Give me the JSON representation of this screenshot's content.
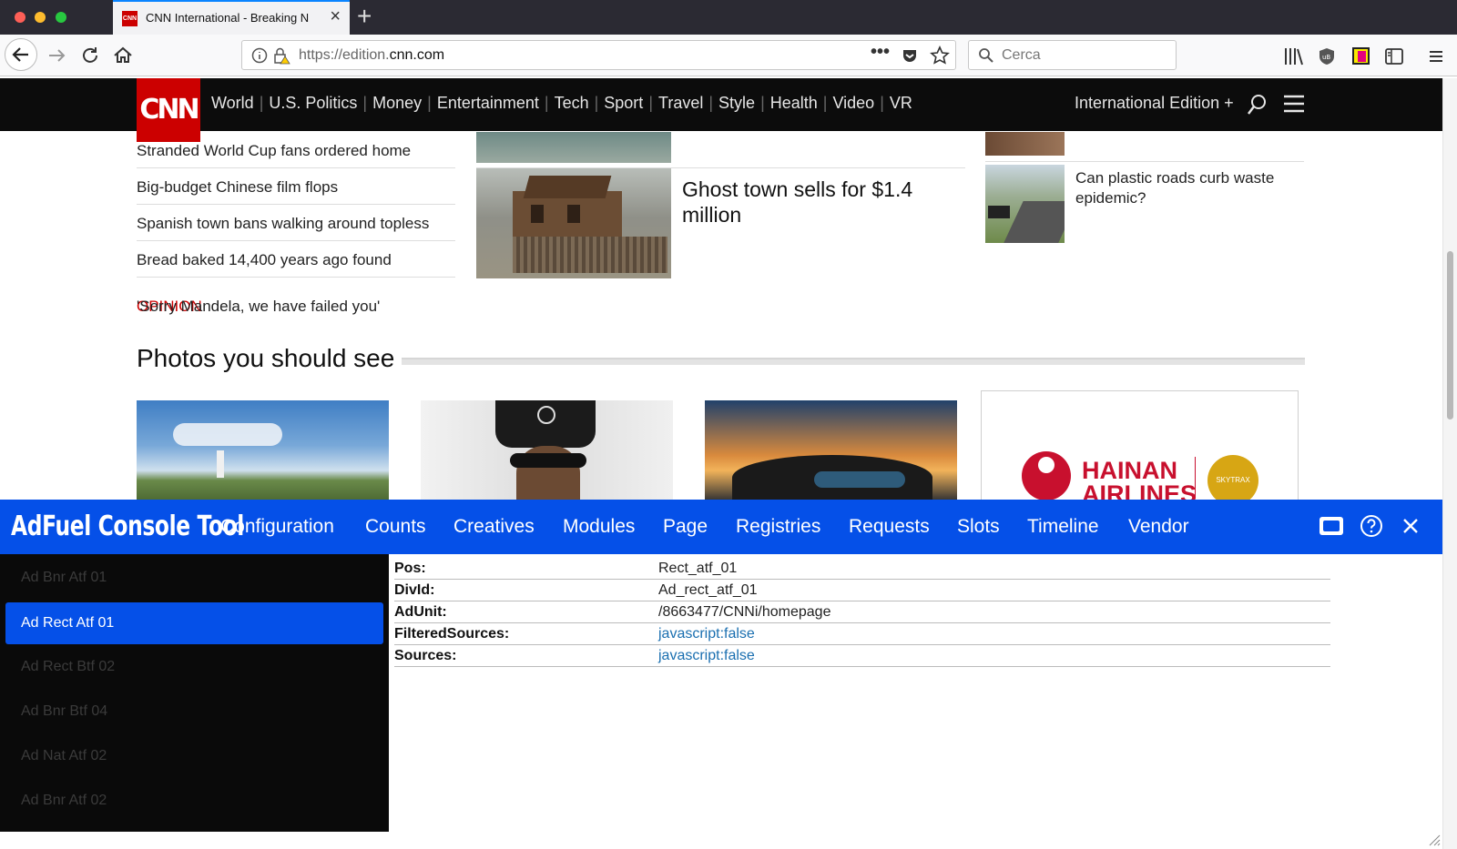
{
  "browser": {
    "tab_title": "CNN International - Breaking N",
    "favicon_text": "CNN",
    "url_prefix": "https://edition.",
    "url_domain": "cnn.com",
    "search_placeholder": "Cerca"
  },
  "cnn": {
    "logo": "CNN",
    "nav": [
      "World",
      "U.S. Politics",
      "Money",
      "Entertainment",
      "Tech",
      "Sport",
      "Travel",
      "Style",
      "Health",
      "Video",
      "VR"
    ],
    "edition": "International Edition +",
    "headlines": [
      "Stranded World Cup fans ordered home",
      "Big-budget Chinese film flops",
      "Spanish town bans walking around topless",
      "Bread baked 14,400 years ago found"
    ],
    "opinion_label": "OPINION",
    "opinion_text": " 'Sorry Mandela, we have failed you'",
    "feature_headline": "Ghost town sells for $1.4 million",
    "side_headline": "Can plastic roads curb waste epidemic?",
    "photos_heading": "Photos you should see",
    "ad_brand_line1": "HAINAN",
    "ad_brand_line2": "AIRLINES",
    "ad_badge": "SKYTRAX"
  },
  "console": {
    "title": "AdFuel Console Tool",
    "menu": [
      "Configuration",
      "Counts",
      "Creatives",
      "Modules",
      "Page",
      "Registries",
      "Requests",
      "Slots",
      "Timeline",
      "Vendor"
    ],
    "slots": [
      "Ad Bnr Atf 01",
      "Ad Rect Atf 01",
      "Ad Rect Btf 02",
      "Ad Bnr Btf 04",
      "Ad Nat Atf 02",
      "Ad Bnr Atf 02"
    ],
    "selected_slot_index": 1,
    "details": [
      {
        "key": "Pos:",
        "value": "Rect_atf_01"
      },
      {
        "key": "DivId:",
        "value": "Ad_rect_atf_01"
      },
      {
        "key": "AdUnit:",
        "value": "/8663477/CNNi/homepage"
      },
      {
        "key": "FilteredSources:",
        "value": "javascript:false"
      },
      {
        "key": "Sources:",
        "value": "javascript:false"
      }
    ]
  },
  "colors": {
    "cnn_red": "#cc0000",
    "console_blue": "#0550e8",
    "link_blue": "#1a6fb0"
  }
}
